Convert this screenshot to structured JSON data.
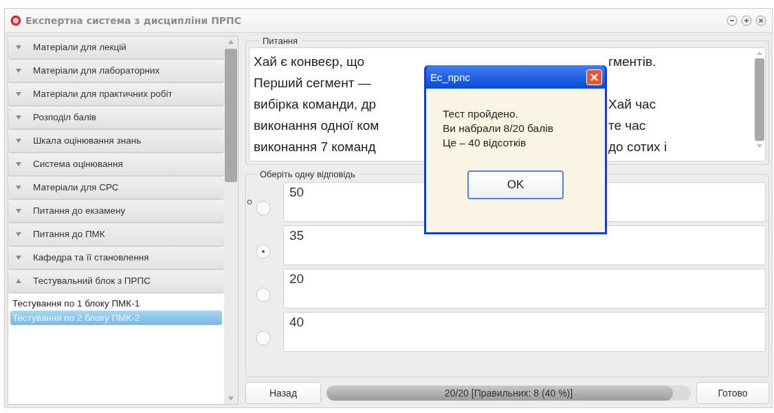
{
  "window": {
    "title": "Експертна система з дисципліни ПРПС"
  },
  "sidebar": {
    "items": [
      {
        "label": "Матеріали для лекцій",
        "expanded": false
      },
      {
        "label": "Матеріали для лабораторних",
        "expanded": false
      },
      {
        "label": "Матеріали для практичних робіт",
        "expanded": false
      },
      {
        "label": "Розподіл балів",
        "expanded": false
      },
      {
        "label": "Шкала оцінювання знань",
        "expanded": false
      },
      {
        "label": "Система оцінювання",
        "expanded": false
      },
      {
        "label": "Матеріали для СРС",
        "expanded": false
      },
      {
        "label": "Питання до екзамену",
        "expanded": false
      },
      {
        "label": "Питання до ПМК",
        "expanded": false
      },
      {
        "label": "Кафедра та її становлення",
        "expanded": false
      },
      {
        "label": "Тестувальний блок з ПРПС",
        "expanded": true,
        "children": [
          {
            "label": "Тестування по 1 блоку ПМК-1",
            "selected": false
          },
          {
            "label": "Тестування по 2 блоку ПМК-2",
            "selected": true
          }
        ]
      }
    ]
  },
  "question": {
    "legend": "Питання",
    "lines": [
      {
        "left": "Хай є конвеєр, що",
        "right": "гментів."
      },
      {
        "left": "Перший сегмент —"
      },
      {
        "left": "вибірка команди, др",
        "right": "Хай час"
      },
      {
        "left": "виконання  одної ком",
        "right": "те час"
      },
      {
        "left": "виконання 7 команд",
        "right": "до сотих і"
      }
    ]
  },
  "answers": {
    "legend": "Оберіть одну відповідь",
    "options": [
      {
        "text": "50",
        "selected": false,
        "focused": true
      },
      {
        "text": "35",
        "selected": true,
        "focused": false
      },
      {
        "text": "20",
        "selected": false,
        "focused": false
      },
      {
        "text": "40",
        "selected": false,
        "focused": false
      }
    ]
  },
  "footer": {
    "back": "Назад",
    "progress": {
      "label": "20/20 [Правильних: 8 (40 %)]",
      "level": 0.95
    },
    "done": "Готово"
  },
  "dialog": {
    "title": "Ес_прпс",
    "lines": [
      "Тест пройдено.",
      "Ви набрали 8/20 балів",
      "Це – 40 відсотків"
    ],
    "button": "OK"
  }
}
